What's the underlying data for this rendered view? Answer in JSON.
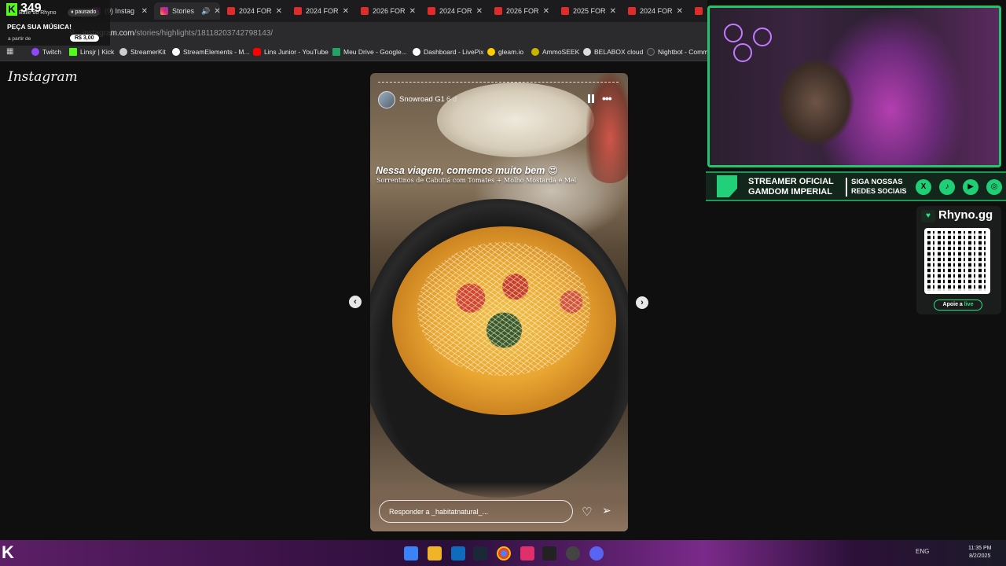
{
  "tabs": [
    {
      "label": "Baile do Rhyno",
      "icon": "kick-icon",
      "active": false
    },
    {
      "label": "(9) Instag",
      "icon": "instagram-icon",
      "active": false
    },
    {
      "label": "Stories",
      "icon": "instagram-icon",
      "active": true
    },
    {
      "label": "2024 FOR",
      "icon": "pdf-icon",
      "active": false
    },
    {
      "label": "2024 FOR",
      "icon": "pdf-icon",
      "active": false
    },
    {
      "label": "2026 FOR",
      "icon": "pdf-icon",
      "active": false
    },
    {
      "label": "2024 FOR",
      "icon": "pdf-icon",
      "active": false
    },
    {
      "label": "2026 FOR",
      "icon": "pdf-icon",
      "active": false
    },
    {
      "label": "2025 FOR",
      "icon": "pdf-icon",
      "active": false
    },
    {
      "label": "2024 FOR",
      "icon": "pdf-icon",
      "active": false
    }
  ],
  "overlay": {
    "count": "349",
    "title": "Baile do Rhyno",
    "status": "pausado",
    "request": "PEÇA SUA MÚSICA!",
    "from": "a partir de",
    "price": "R$ 3,00"
  },
  "address": {
    "domain": "instagram.com",
    "path": "/stories/highlights/18118203742798143/"
  },
  "bookmarks": [
    {
      "label": "Twitch",
      "color": "#9146ff"
    },
    {
      "label": "Linsjr | Kick",
      "color": "#53fc18"
    },
    {
      "label": "StreamerKit",
      "color": "#cccccc"
    },
    {
      "label": "StreamElements - M...",
      "color": "#ffffff"
    },
    {
      "label": "Lins Junior - YouTube",
      "color": "#ff0000"
    },
    {
      "label": "Meu Drive - Google...",
      "color": "#1fa463"
    },
    {
      "label": "Dashboard - LivePix",
      "color": "#ffffff"
    },
    {
      "label": "gleam.io",
      "color": "#ffcc00"
    },
    {
      "label": "AmmoSEEK",
      "color": "#c8b400"
    },
    {
      "label": "BELABOX cloud",
      "color": "#dddddd"
    },
    {
      "label": "Nightbot - Comm",
      "color": "#333333"
    }
  ],
  "instagram": {
    "logo": "Instagram",
    "story": {
      "username": "Snowroad G1",
      "time": "6 d",
      "caption": "Nessa viagem, comemos muito bem 😍",
      "subcaption": "Sorrentinos de Cabutiá com Tomates + Molho Mostarda e Mel",
      "reply_placeholder": "Responder a _habitatnatural_..."
    }
  },
  "stream": {
    "banner_line1": "STREAMER OFICIAL",
    "banner_line2": "GAMDOM IMPERIAL",
    "banner_line3": "SIGA NOSSAS",
    "banner_line4": "REDES SOCIAIS",
    "socials": [
      "x-icon",
      "tiktok-icon",
      "youtube-icon",
      "instagram-icon"
    ],
    "qr_brand": "Rhyno.gg",
    "qr_cta_prefix": "Apoie a",
    "qr_cta_highlight": "live",
    "accent": "#20c76a"
  },
  "taskbar": {
    "tray_lang": "ENG",
    "clock_time": "11:35 PM",
    "clock_date": "8/2/2025"
  }
}
